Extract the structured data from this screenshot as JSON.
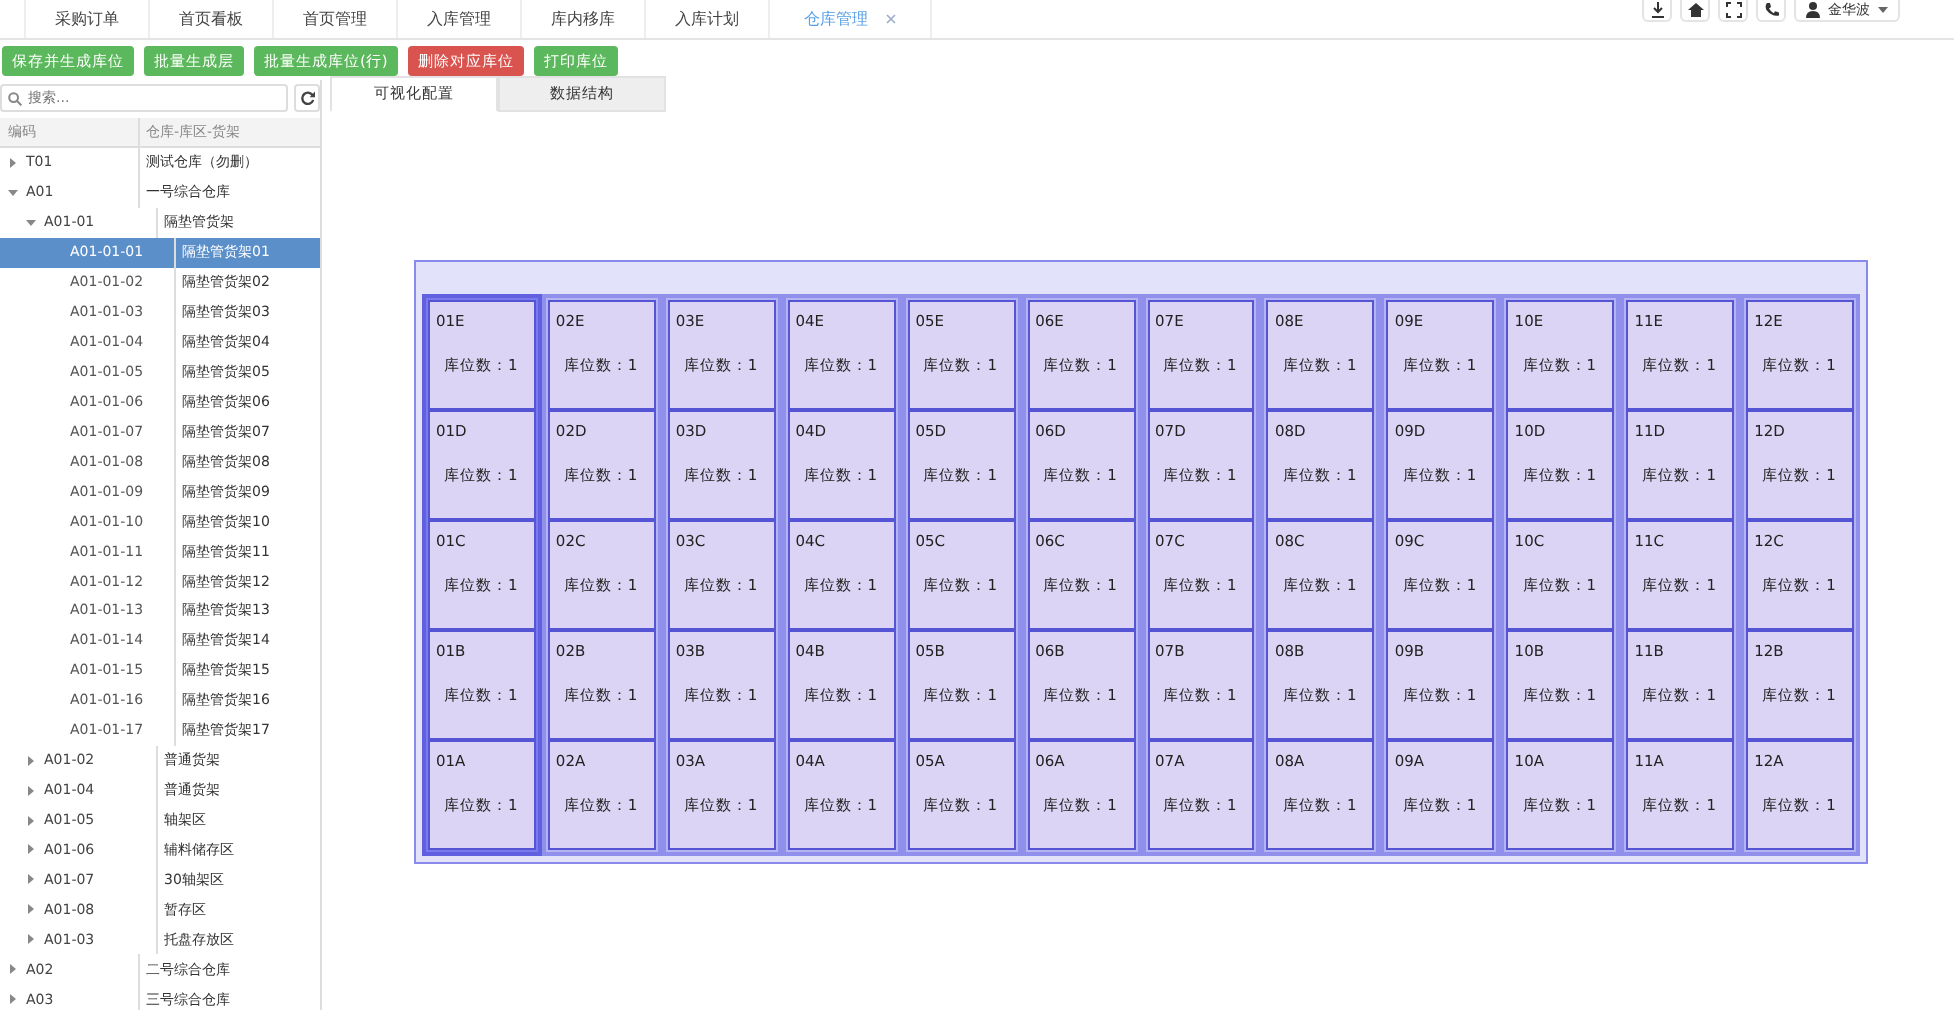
{
  "top_tabs": [
    {
      "label": "采购订单",
      "selected": false,
      "closable": false
    },
    {
      "label": "首页看板",
      "selected": false,
      "closable": false
    },
    {
      "label": "首页管理",
      "selected": false,
      "closable": false
    },
    {
      "label": "入库管理",
      "selected": false,
      "closable": false
    },
    {
      "label": "库内移库",
      "selected": false,
      "closable": false
    },
    {
      "label": "入库计划",
      "selected": false,
      "closable": false
    },
    {
      "label": "仓库管理",
      "selected": true,
      "closable": true
    }
  ],
  "user": {
    "name": "金华波"
  },
  "toolbar": [
    {
      "label": "保存并生成库位",
      "kind": "success"
    },
    {
      "label": "批量生成层",
      "kind": "success"
    },
    {
      "label": "批量生成库位(行)",
      "kind": "success"
    },
    {
      "label": "删除对应库位",
      "kind": "danger"
    },
    {
      "label": "打印库位",
      "kind": "success"
    }
  ],
  "search": {
    "placeholder": "搜索..."
  },
  "tree": {
    "columns": [
      "编码",
      "仓库-库区-货架"
    ],
    "items": [
      {
        "code": "T01",
        "name": "测试仓库（勿删）",
        "expanded": false,
        "selected": false
      },
      {
        "code": "A01",
        "name": "一号综合仓库",
        "expanded": true,
        "selected": false,
        "children": [
          {
            "code": "A01-01",
            "name": "隔垫管货架",
            "expanded": true,
            "selected": false,
            "children": [
              {
                "code": "A01-01-01",
                "name": "隔垫管货架01",
                "selected": true
              },
              {
                "code": "A01-01-02",
                "name": "隔垫管货架02",
                "selected": false
              },
              {
                "code": "A01-01-03",
                "name": "隔垫管货架03",
                "selected": false
              },
              {
                "code": "A01-01-04",
                "name": "隔垫管货架04",
                "selected": false
              },
              {
                "code": "A01-01-05",
                "name": "隔垫管货架05",
                "selected": false
              },
              {
                "code": "A01-01-06",
                "name": "隔垫管货架06",
                "selected": false
              },
              {
                "code": "A01-01-07",
                "name": "隔垫管货架07",
                "selected": false
              },
              {
                "code": "A01-01-08",
                "name": "隔垫管货架08",
                "selected": false
              },
              {
                "code": "A01-01-09",
                "name": "隔垫管货架09",
                "selected": false
              },
              {
                "code": "A01-01-10",
                "name": "隔垫管货架10",
                "selected": false
              },
              {
                "code": "A01-01-11",
                "name": "隔垫管货架11",
                "selected": false
              },
              {
                "code": "A01-01-12",
                "name": "隔垫管货架12",
                "selected": false
              },
              {
                "code": "A01-01-13",
                "name": "隔垫管货架13",
                "selected": false
              },
              {
                "code": "A01-01-14",
                "name": "隔垫管货架14",
                "selected": false
              },
              {
                "code": "A01-01-15",
                "name": "隔垫管货架15",
                "selected": false
              },
              {
                "code": "A01-01-16",
                "name": "隔垫管货架16",
                "selected": false
              },
              {
                "code": "A01-01-17",
                "name": "隔垫管货架17",
                "selected": false
              }
            ]
          },
          {
            "code": "A01-02",
            "name": "普通货架",
            "expanded": false,
            "selected": false
          },
          {
            "code": "A01-04",
            "name": "普通货架",
            "expanded": false,
            "selected": false
          },
          {
            "code": "A01-05",
            "name": "轴架区",
            "expanded": false,
            "selected": false
          },
          {
            "code": "A01-06",
            "name": "辅料储存区",
            "expanded": false,
            "selected": false
          },
          {
            "code": "A01-07",
            "name": "30轴架区",
            "expanded": false,
            "selected": false
          },
          {
            "code": "A01-08",
            "name": "暂存区",
            "expanded": false,
            "selected": false
          },
          {
            "code": "A01-03",
            "name": "托盘存放区",
            "expanded": false,
            "selected": false
          }
        ]
      },
      {
        "code": "A02",
        "name": "二号综合仓库",
        "expanded": false,
        "selected": false
      },
      {
        "code": "A03",
        "name": "三号综合仓库",
        "expanded": false,
        "selected": false
      }
    ]
  },
  "view_tabs": [
    {
      "label": "可视化配置",
      "selected": true
    },
    {
      "label": "数据结构",
      "selected": false
    }
  ],
  "rack": {
    "columns": [
      {
        "selected": true,
        "cells": [
          {
            "code": "01E",
            "count": "库位数：1"
          },
          {
            "code": "01D",
            "count": "库位数：1"
          },
          {
            "code": "01C",
            "count": "库位数：1"
          },
          {
            "code": "01B",
            "count": "库位数：1"
          },
          {
            "code": "01A",
            "count": "库位数：1"
          }
        ]
      },
      {
        "selected": false,
        "cells": [
          {
            "code": "02E",
            "count": "库位数：1"
          },
          {
            "code": "02D",
            "count": "库位数：1"
          },
          {
            "code": "02C",
            "count": "库位数：1"
          },
          {
            "code": "02B",
            "count": "库位数：1"
          },
          {
            "code": "02A",
            "count": "库位数：1"
          }
        ]
      },
      {
        "selected": false,
        "cells": [
          {
            "code": "03E",
            "count": "库位数：1"
          },
          {
            "code": "03D",
            "count": "库位数：1"
          },
          {
            "code": "03C",
            "count": "库位数：1"
          },
          {
            "code": "03B",
            "count": "库位数：1"
          },
          {
            "code": "03A",
            "count": "库位数：1"
          }
        ]
      },
      {
        "selected": false,
        "cells": [
          {
            "code": "04E",
            "count": "库位数：1"
          },
          {
            "code": "04D",
            "count": "库位数：1"
          },
          {
            "code": "04C",
            "count": "库位数：1"
          },
          {
            "code": "04B",
            "count": "库位数：1"
          },
          {
            "code": "04A",
            "count": "库位数：1"
          }
        ]
      },
      {
        "selected": false,
        "cells": [
          {
            "code": "05E",
            "count": "库位数：1"
          },
          {
            "code": "05D",
            "count": "库位数：1"
          },
          {
            "code": "05C",
            "count": "库位数：1"
          },
          {
            "code": "05B",
            "count": "库位数：1"
          },
          {
            "code": "05A",
            "count": "库位数：1"
          }
        ]
      },
      {
        "selected": false,
        "cells": [
          {
            "code": "06E",
            "count": "库位数：1"
          },
          {
            "code": "06D",
            "count": "库位数：1"
          },
          {
            "code": "06C",
            "count": "库位数：1"
          },
          {
            "code": "06B",
            "count": "库位数：1"
          },
          {
            "code": "06A",
            "count": "库位数：1"
          }
        ]
      },
      {
        "selected": false,
        "cells": [
          {
            "code": "07E",
            "count": "库位数：1"
          },
          {
            "code": "07D",
            "count": "库位数：1"
          },
          {
            "code": "07C",
            "count": "库位数：1"
          },
          {
            "code": "07B",
            "count": "库位数：1"
          },
          {
            "code": "07A",
            "count": "库位数：1"
          }
        ]
      },
      {
        "selected": false,
        "cells": [
          {
            "code": "08E",
            "count": "库位数：1"
          },
          {
            "code": "08D",
            "count": "库位数：1"
          },
          {
            "code": "08C",
            "count": "库位数：1"
          },
          {
            "code": "08B",
            "count": "库位数：1"
          },
          {
            "code": "08A",
            "count": "库位数：1"
          }
        ]
      },
      {
        "selected": false,
        "cells": [
          {
            "code": "09E",
            "count": "库位数：1"
          },
          {
            "code": "09D",
            "count": "库位数：1"
          },
          {
            "code": "09C",
            "count": "库位数：1"
          },
          {
            "code": "09B",
            "count": "库位数：1"
          },
          {
            "code": "09A",
            "count": "库位数：1"
          }
        ]
      },
      {
        "selected": false,
        "cells": [
          {
            "code": "10E",
            "count": "库位数：1"
          },
          {
            "code": "10D",
            "count": "库位数：1"
          },
          {
            "code": "10C",
            "count": "库位数：1"
          },
          {
            "code": "10B",
            "count": "库位数：1"
          },
          {
            "code": "10A",
            "count": "库位数：1"
          }
        ]
      },
      {
        "selected": false,
        "cells": [
          {
            "code": "11E",
            "count": "库位数：1"
          },
          {
            "code": "11D",
            "count": "库位数：1"
          },
          {
            "code": "11C",
            "count": "库位数：1"
          },
          {
            "code": "11B",
            "count": "库位数：1"
          },
          {
            "code": "11A",
            "count": "库位数：1"
          }
        ]
      },
      {
        "selected": false,
        "cells": [
          {
            "code": "12E",
            "count": "库位数：1"
          },
          {
            "code": "12D",
            "count": "库位数：1"
          },
          {
            "code": "12C",
            "count": "库位数：1"
          },
          {
            "code": "12B",
            "count": "库位数：1"
          },
          {
            "code": "12A",
            "count": "库位数：1"
          }
        ]
      }
    ]
  }
}
